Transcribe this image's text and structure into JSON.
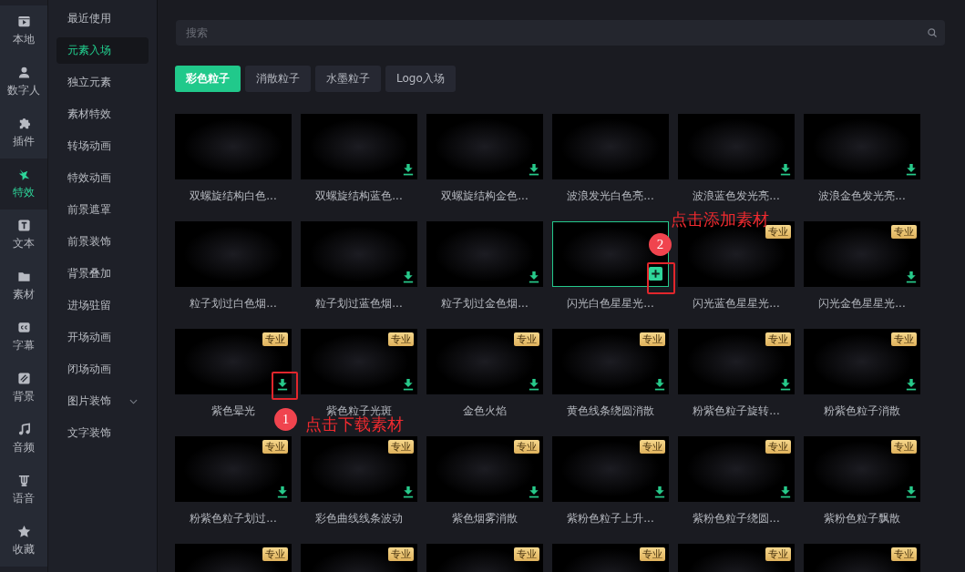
{
  "rail": [
    {
      "label": "本地",
      "kind": "film",
      "selected": false
    },
    {
      "label": "数字人",
      "kind": "person",
      "selected": false
    },
    {
      "label": "插件",
      "kind": "puzzle",
      "selected": false
    },
    {
      "label": "特效",
      "kind": "sparkle",
      "selected": true
    },
    {
      "label": "文本",
      "kind": "text",
      "selected": false
    },
    {
      "label": "素材",
      "kind": "folder",
      "selected": false
    },
    {
      "label": "字幕",
      "kind": "captions",
      "selected": false
    },
    {
      "label": "背景",
      "kind": "background",
      "selected": false
    },
    {
      "label": "音频",
      "kind": "music",
      "selected": false
    },
    {
      "label": "语音",
      "kind": "voice",
      "selected": false
    },
    {
      "label": "收藏",
      "kind": "star",
      "selected": false
    }
  ],
  "categories": [
    {
      "label": "最近使用",
      "selected": false,
      "expandable": false
    },
    {
      "label": "元素入场",
      "selected": true,
      "expandable": false
    },
    {
      "label": "独立元素",
      "selected": false,
      "expandable": false
    },
    {
      "label": "素材特效",
      "selected": false,
      "expandable": false
    },
    {
      "label": "转场动画",
      "selected": false,
      "expandable": false
    },
    {
      "label": "特效动画",
      "selected": false,
      "expandable": false
    },
    {
      "label": "前景遮罩",
      "selected": false,
      "expandable": false
    },
    {
      "label": "前景装饰",
      "selected": false,
      "expandable": false
    },
    {
      "label": "背景叠加",
      "selected": false,
      "expandable": false
    },
    {
      "label": "进场驻留",
      "selected": false,
      "expandable": false
    },
    {
      "label": "开场动画",
      "selected": false,
      "expandable": false
    },
    {
      "label": "闭场动画",
      "selected": false,
      "expandable": false
    },
    {
      "label": "图片装饰",
      "selected": false,
      "expandable": true
    },
    {
      "label": "文字装饰",
      "selected": false,
      "expandable": false
    }
  ],
  "search": {
    "placeholder": "搜索"
  },
  "tabs": [
    {
      "label": "彩色粒子",
      "selected": true
    },
    {
      "label": "消散粒子",
      "selected": false
    },
    {
      "label": "水墨粒子",
      "selected": false
    },
    {
      "label": "Logo入场",
      "selected": false
    }
  ],
  "items": [
    {
      "title": "双螺旋结构白色...",
      "download": false,
      "selected": false
    },
    {
      "title": "双螺旋结构蓝色...",
      "download": true,
      "selected": false
    },
    {
      "title": "双螺旋结构金色...",
      "download": true,
      "selected": false
    },
    {
      "title": "波浪发光白色亮...",
      "download": false,
      "selected": false
    },
    {
      "title": "波浪蓝色发光亮...",
      "download": true,
      "selected": false
    },
    {
      "title": "波浪金色发光亮...",
      "download": true,
      "selected": false
    },
    {
      "title": "粒子划过白色烟...",
      "download": false,
      "selected": false
    },
    {
      "title": "粒子划过蓝色烟...",
      "download": true,
      "selected": false
    },
    {
      "title": "粒子划过金色烟...",
      "download": true,
      "selected": false
    },
    {
      "title": "闪光白色星星光...",
      "download": false,
      "selected": true,
      "callout": {
        "number": "2",
        "text": "点击添加素材"
      }
    },
    {
      "title": "闪光蓝色星星光...",
      "badge": "专业",
      "download": false,
      "selected": false
    },
    {
      "title": "闪光金色星星光...",
      "badge": "专业",
      "download": true,
      "selected": false
    },
    {
      "title": "紫色晕光",
      "badge": "专业",
      "download": true,
      "selected": false,
      "callout": {
        "number": "1",
        "text": "点击下载素材"
      }
    },
    {
      "title": "紫色粒子光斑",
      "badge": "专业",
      "download": true,
      "selected": false
    },
    {
      "title": "金色火焰",
      "badge": "专业",
      "download": true,
      "selected": false
    },
    {
      "title": "黄色线条绕圆消散",
      "badge": "专业",
      "download": true,
      "selected": false
    },
    {
      "title": "粉紫色粒子旋转...",
      "badge": "专业",
      "download": true,
      "selected": false
    },
    {
      "title": "粉紫色粒子消散",
      "badge": "专业",
      "download": true,
      "selected": false
    },
    {
      "title": "粉紫色粒子划过...",
      "badge": "专业",
      "download": true,
      "selected": false
    },
    {
      "title": "彩色曲线线条波动",
      "badge": "专业",
      "download": true,
      "selected": false
    },
    {
      "title": "紫色烟雾消散",
      "badge": "专业",
      "download": true,
      "selected": false
    },
    {
      "title": "紫粉色粒子上升...",
      "badge": "专业",
      "download": true,
      "selected": false
    },
    {
      "title": "紫粉色粒子绕圆...",
      "badge": "专业",
      "download": true,
      "selected": false
    },
    {
      "title": "紫粉色粒子飘散",
      "badge": "专业",
      "download": true,
      "selected": false
    },
    {
      "badge": "专业",
      "download": false,
      "selected": false
    },
    {
      "badge": "专业",
      "download": false,
      "selected": false
    },
    {
      "badge": "专业",
      "download": false,
      "selected": false
    },
    {
      "badge": "专业",
      "download": false,
      "selected": false
    },
    {
      "badge": "专业",
      "download": false,
      "selected": false
    },
    {
      "badge": "专业",
      "download": false,
      "selected": false
    }
  ]
}
